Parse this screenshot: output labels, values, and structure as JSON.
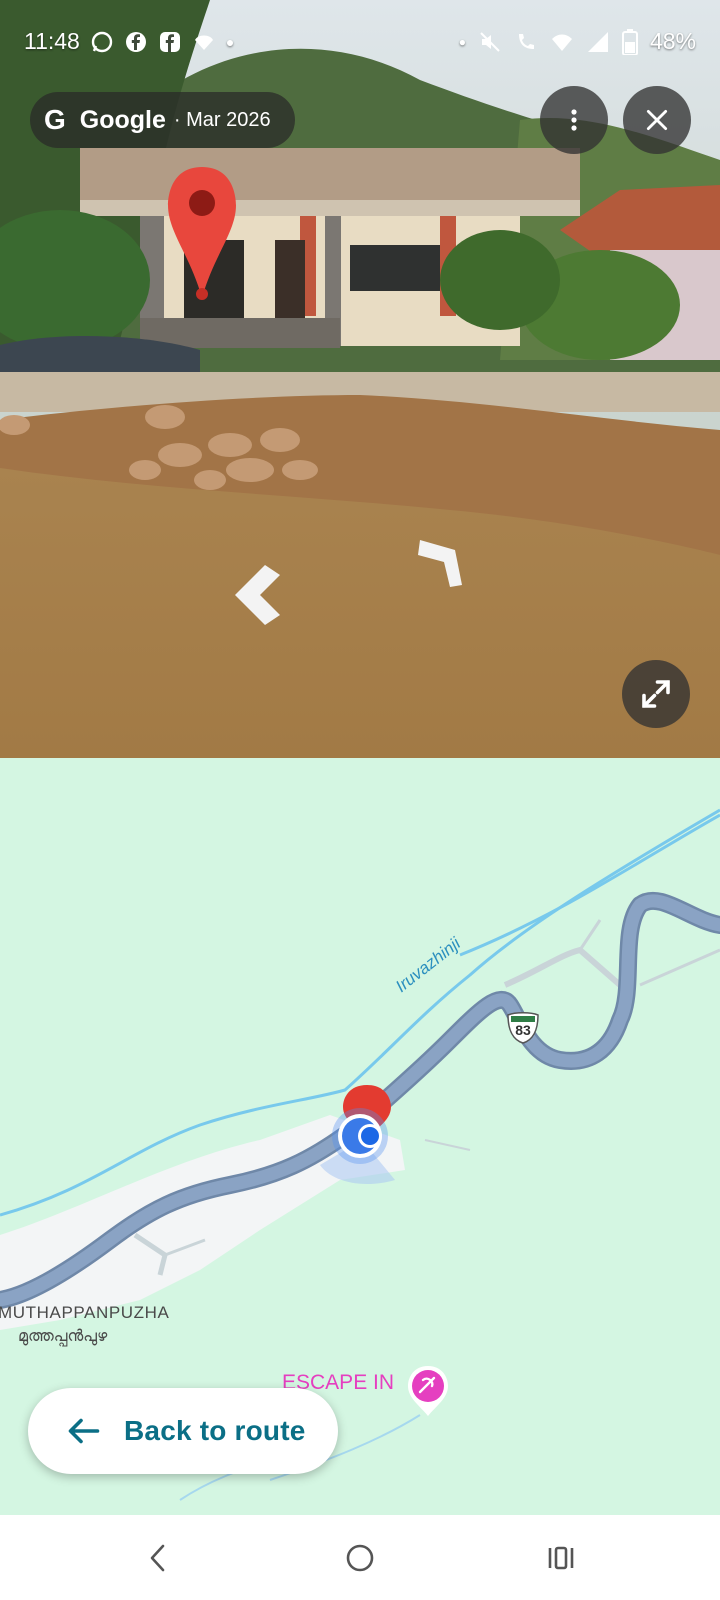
{
  "status_bar": {
    "time": "11:48",
    "battery": "48%"
  },
  "street_view": {
    "brand": "Google",
    "date": "· Mar 2026",
    "more_icon": "more-vert-icon",
    "close_icon": "close-icon",
    "expand_icon": "expand-icon"
  },
  "map": {
    "river_label": "Iruvazhinji",
    "road_shield": "83",
    "place_label_en": "MUTHAPPANPUZHA",
    "place_label_ml": "മുത്തപ്പൻപുഴ",
    "poi_label": "ESCAPE IN",
    "colors": {
      "land": "#d4f6e2",
      "road": "#8aa3c4",
      "river": "#6ec5ea",
      "poi": "#e53fc0",
      "accent": "#0b6f86"
    }
  },
  "back_to_route": {
    "label": "Back to route"
  }
}
